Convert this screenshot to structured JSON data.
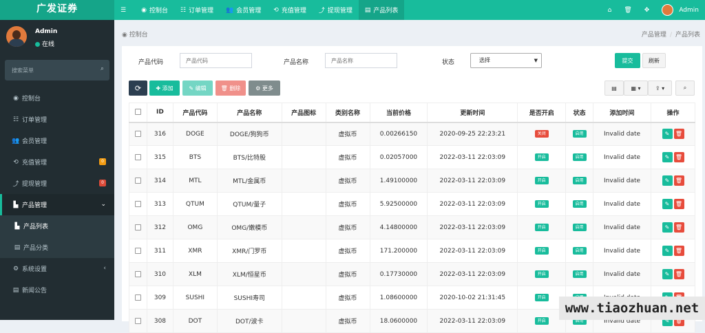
{
  "logo": "广发证券",
  "topnav": [
    {
      "icon": "☰",
      "label": ""
    },
    {
      "icon": "◉",
      "label": "控制台"
    },
    {
      "icon": "☷",
      "label": "订单管理"
    },
    {
      "icon": "👥",
      "label": "会员管理"
    },
    {
      "icon": "⟲",
      "label": "充值管理"
    },
    {
      "icon": "⤴",
      "label": "提现管理"
    },
    {
      "icon": "▤",
      "label": "产品列表"
    }
  ],
  "topright": {
    "home_icon": "⌂",
    "trash_icon": "🗑",
    "expand_icon": "✥",
    "user": "Admin"
  },
  "user": {
    "name": "Admin",
    "status": "在线"
  },
  "search": {
    "placeholder": "搜索菜单",
    "icon": "⌕"
  },
  "menu": [
    {
      "icon": "◉",
      "label": "控制台"
    },
    {
      "icon": "☷",
      "label": "订单管理"
    },
    {
      "icon": "👥",
      "label": "会员管理"
    },
    {
      "icon": "⟲",
      "label": "充值管理",
      "badge": "0",
      "badge_color": "#f39c12"
    },
    {
      "icon": "⤴",
      "label": "提现管理",
      "badge": "0",
      "badge_color": "#dd4b39"
    },
    {
      "icon": "▙",
      "label": "产品管理",
      "chev": "⌄"
    },
    {
      "icon": "▙",
      "label": "产品列表"
    },
    {
      "icon": "▤",
      "label": "产品分类"
    },
    {
      "icon": "⚙",
      "label": "系统设置",
      "chev": "‹"
    },
    {
      "icon": "▤",
      "label": "新闻公告"
    }
  ],
  "breadcrumb": {
    "title": "控制台",
    "path1": "产品管理",
    "sep": "/",
    "path2": "产品列表"
  },
  "filter": {
    "code_label": "产品代码",
    "code_placeholder": "产品代码",
    "name_label": "产品名称",
    "name_placeholder": "产品名称",
    "status_label": "状态",
    "status_value": "选择",
    "submit": "提交",
    "reset": "刷新"
  },
  "toolbar": {
    "refresh": "⟳",
    "add": "✚ 添加",
    "edit": "✎ 编辑",
    "delete": "🗑 删除",
    "more": "⚙ 更多",
    "columns_icon": "▤",
    "grid_icon": "▦ ▾",
    "export_icon": "⇪ ▾",
    "search_icon": "⌕"
  },
  "table": {
    "headers": [
      "",
      "ID",
      "产品代码",
      "产品名称",
      "产品图标",
      "类别名称",
      "当前价格",
      "更新时间",
      "是否开启",
      "状态",
      "添加时间",
      "操作"
    ],
    "rows": [
      {
        "id": "316",
        "code": "DOGE",
        "name": "DOGE/狗狗币",
        "cat": "虚拟币",
        "price": "0.00266150",
        "updated": "2020-09-25 22:23:21",
        "open": "关闭",
        "open_color": "red",
        "status": "启用",
        "added": "Invalid date"
      },
      {
        "id": "315",
        "code": "BTS",
        "name": "BTS/比特股",
        "cat": "虚拟币",
        "price": "0.02057000",
        "updated": "2022-03-11 22:03:09",
        "open": "开启",
        "open_color": "green",
        "status": "启用",
        "added": "Invalid date"
      },
      {
        "id": "314",
        "code": "MTL",
        "name": "MTL/金属币",
        "cat": "虚拟币",
        "price": "1.49100000",
        "updated": "2022-03-11 22:03:09",
        "open": "开启",
        "open_color": "green",
        "status": "启用",
        "added": "Invalid date"
      },
      {
        "id": "313",
        "code": "QTUM",
        "name": "QTUM/量子",
        "cat": "虚拟币",
        "price": "5.92500000",
        "updated": "2022-03-11 22:03:09",
        "open": "开启",
        "open_color": "green",
        "status": "启用",
        "added": "Invalid date"
      },
      {
        "id": "312",
        "code": "OMG",
        "name": "OMG/嫩模币",
        "cat": "虚拟币",
        "price": "4.14800000",
        "updated": "2022-03-11 22:03:09",
        "open": "开启",
        "open_color": "green",
        "status": "启用",
        "added": "Invalid date"
      },
      {
        "id": "311",
        "code": "XMR",
        "name": "XMR/门罗币",
        "cat": "虚拟币",
        "price": "171.200000",
        "updated": "2022-03-11 22:03:09",
        "open": "开启",
        "open_color": "green",
        "status": "启用",
        "added": "Invalid date"
      },
      {
        "id": "310",
        "code": "XLM",
        "name": "XLM/恒星币",
        "cat": "虚拟币",
        "price": "0.17730000",
        "updated": "2022-03-11 22:03:09",
        "open": "开启",
        "open_color": "green",
        "status": "启用",
        "added": "Invalid date"
      },
      {
        "id": "309",
        "code": "SUSHI",
        "name": "SUSHI寿司",
        "cat": "虚拟币",
        "price": "1.08600000",
        "updated": "2020-10-02 21:31:45",
        "open": "开启",
        "open_color": "green",
        "status": "启用",
        "added": "Invalid date"
      },
      {
        "id": "308",
        "code": "DOT",
        "name": "DOT/波卡",
        "cat": "虚拟币",
        "price": "18.0600000",
        "updated": "2022-03-11 22:03:09",
        "open": "开启",
        "open_color": "green",
        "status": "启用",
        "added": "Invalid date"
      }
    ],
    "edit_icon": "✎",
    "delete_icon": "🗑"
  },
  "watermark": "www.tiaozhuan.net",
  "colors": {
    "primary": "#18bc9c",
    "danger": "#e74c3c",
    "sidebar": "#222d32"
  }
}
